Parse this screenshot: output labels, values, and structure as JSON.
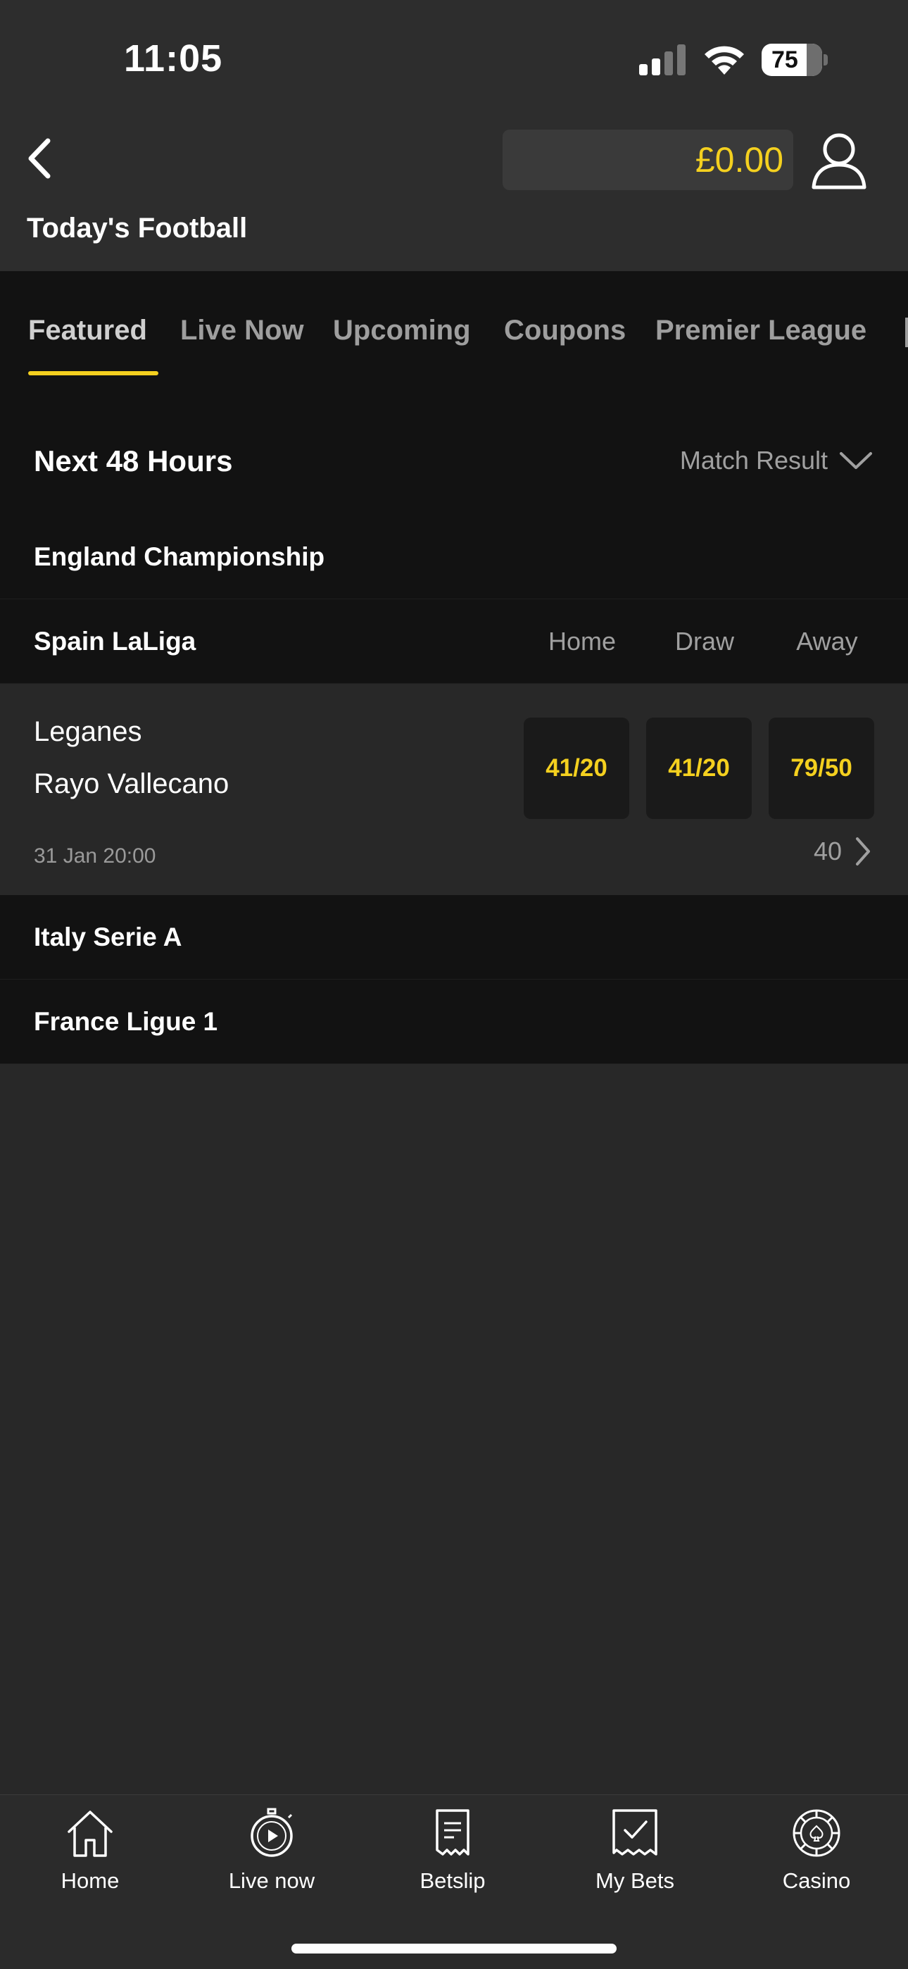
{
  "status_bar": {
    "time": "11:05",
    "battery": "75"
  },
  "header": {
    "balance": "£0.00",
    "title": "Today's Football"
  },
  "tabs": [
    "Featured",
    "Live Now",
    "Upcoming",
    "Coupons",
    "Premier League"
  ],
  "section": {
    "title": "Next 48 Hours",
    "market": "Match Result"
  },
  "leagues": {
    "england": "England Championship",
    "spain": "Spain LaLiga",
    "italy": "Italy Serie A",
    "france": "France Ligue 1"
  },
  "columns": {
    "home": "Home",
    "draw": "Draw",
    "away": "Away"
  },
  "match": {
    "home_team": "Leganes",
    "away_team": "Rayo Vallecano",
    "datetime": "31 Jan 20:00",
    "odds": {
      "home": "41/20",
      "draw": "41/20",
      "away": "79/50"
    },
    "more_markets": "40"
  },
  "bottom_nav": {
    "home": "Home",
    "live": "Live now",
    "betslip": "Betslip",
    "mybets": "My Bets",
    "casino": "Casino"
  },
  "colors": {
    "accent": "#f4d01f",
    "background": "#282828",
    "panel": "#121212"
  }
}
